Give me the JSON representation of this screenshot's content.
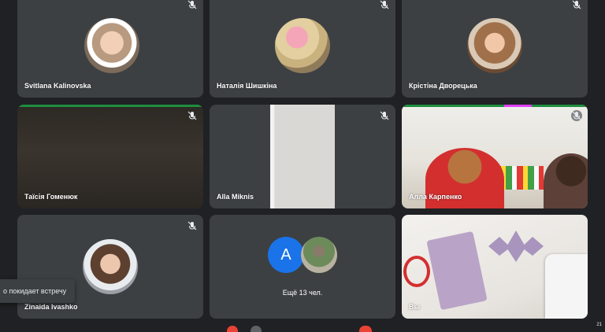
{
  "participants": [
    {
      "name": "Svitlana Kalinovska",
      "muted": true
    },
    {
      "name": "Наталія Шишкіна",
      "muted": true
    },
    {
      "name": "Крістіна Дворецька",
      "muted": true
    },
    {
      "name": "Таїсія Гоменюк",
      "muted": true
    },
    {
      "name": "Alla Miknis",
      "muted": true
    },
    {
      "name": "Алла Карпенко",
      "muted": true
    },
    {
      "name": "Zinaida Ivashko",
      "muted": true
    },
    {
      "name": "Ещё 13 чел.",
      "avatar_letter": "A"
    },
    {
      "name": "Вы"
    }
  ],
  "toast": {
    "text": "о покидает встречу"
  },
  "bottom": {
    "participant_count": "21"
  },
  "colors": {
    "background": "#202124",
    "tile": "#3c4043",
    "avatar_blue": "#1a73e8",
    "speaking_green": "#1e8e3e"
  },
  "icons": [
    "mic-off-icon",
    "people-icon",
    "mic-button-icon",
    "camera-button-icon",
    "end-call-icon"
  ]
}
